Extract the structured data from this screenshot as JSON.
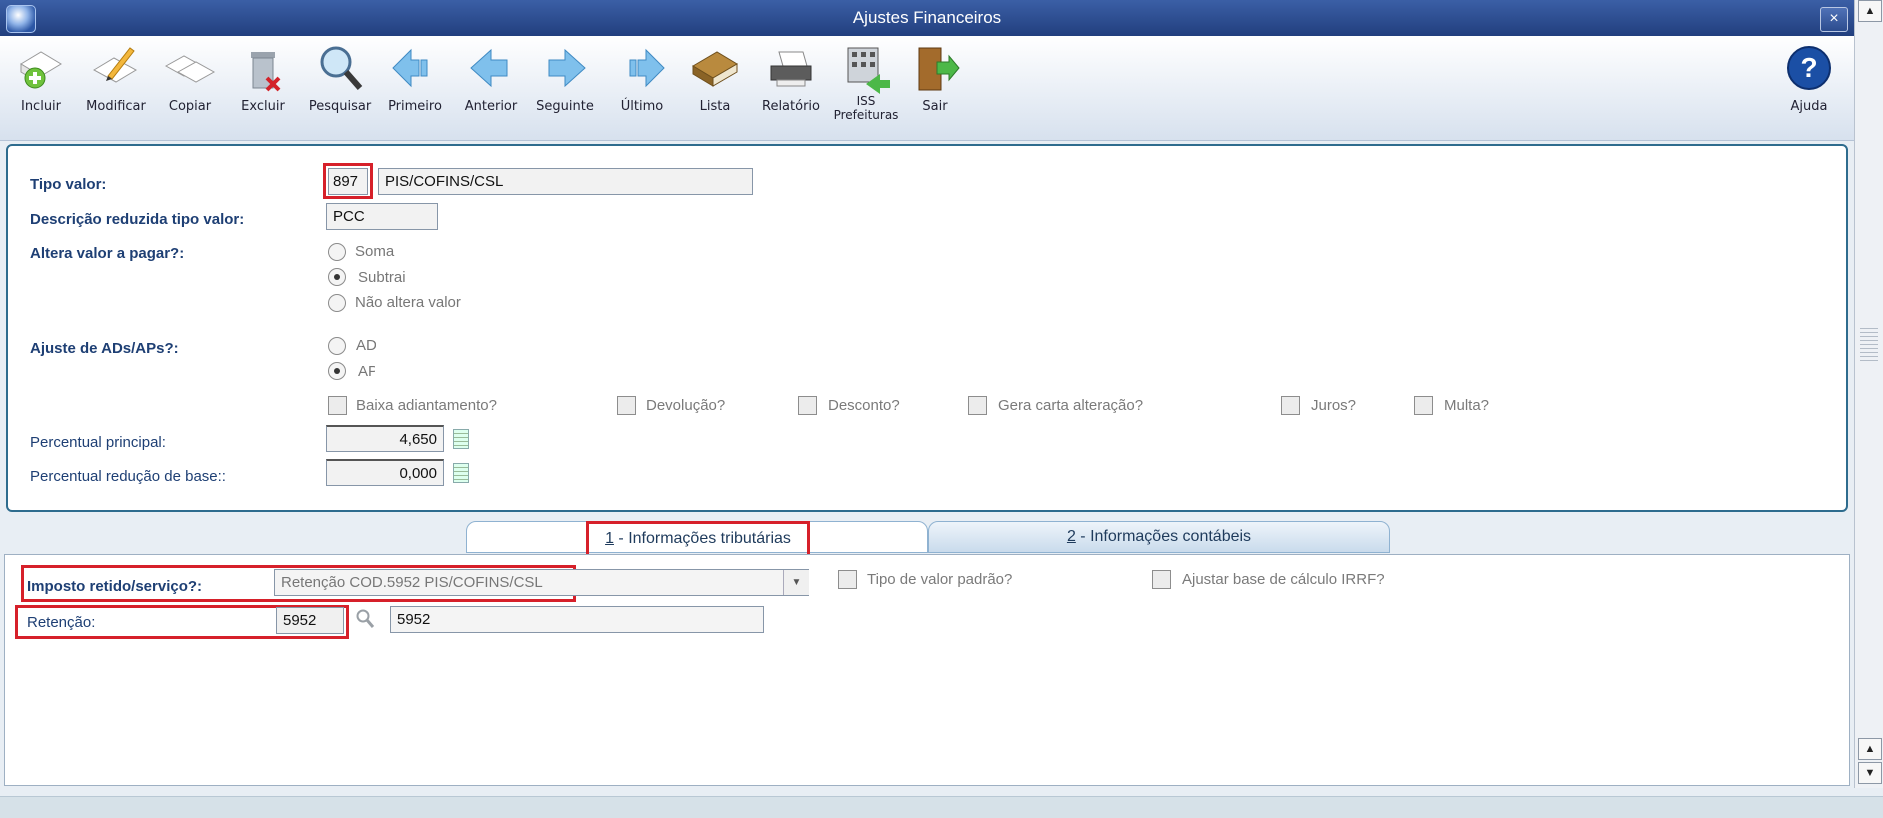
{
  "window": {
    "title": "Ajustes Financeiros",
    "close_label": "×"
  },
  "toolbar": {
    "items": [
      {
        "label": "Incluir",
        "icon": "add-document-icon"
      },
      {
        "label": "Modificar",
        "icon": "edit-document-icon"
      },
      {
        "label": "Copiar",
        "icon": "copy-documents-icon"
      },
      {
        "label": "Excluir",
        "icon": "trash-delete-icon"
      },
      {
        "label": "Pesquisar",
        "icon": "magnifier-icon"
      },
      {
        "label": "Primeiro",
        "icon": "first-arrow-icon"
      },
      {
        "label": "Anterior",
        "icon": "previous-arrow-icon"
      },
      {
        "label": "Seguinte",
        "icon": "next-arrow-icon"
      },
      {
        "label": "Último",
        "icon": "last-arrow-icon"
      },
      {
        "label": "Lista",
        "icon": "book-list-icon"
      },
      {
        "label": "Relatório",
        "icon": "printer-icon"
      },
      {
        "label": "ISS Prefeituras",
        "icon": "building-icon"
      },
      {
        "label": "Sair",
        "icon": "exit-door-icon"
      },
      {
        "label": "Ajuda",
        "icon": "help-question-icon"
      }
    ]
  },
  "form": {
    "tipo_valor": {
      "label": "Tipo valor:",
      "code": "897",
      "description": "PIS/COFINS/CSL"
    },
    "descricao_reduzida": {
      "label": "Descrição reduzida tipo valor:",
      "value": "PCC"
    },
    "altera_valor": {
      "label": "Altera valor a pagar?:",
      "options": [
        "Soma",
        "Subtrai",
        "Não altera valor"
      ],
      "selected": "Subtrai"
    },
    "ajuste_ads": {
      "label": "Ajuste de ADs/APs?:",
      "options": [
        "AD",
        "AP"
      ],
      "selected": "AP"
    },
    "checkboxes": [
      "Baixa adiantamento?",
      "Devolução?",
      "Desconto?",
      "Gera carta alteração?",
      "Juros?",
      "Multa?"
    ],
    "percentual_principal": {
      "label": "Percentual principal:",
      "value": "4,650"
    },
    "percentual_reducao": {
      "label": "Percentual redução de base::",
      "value": "0,000"
    }
  },
  "tabs": [
    {
      "key": "1",
      "label": " - Informações tributárias"
    },
    {
      "key": "2",
      "label": " - Informações contábeis"
    }
  ],
  "tributarias": {
    "imposto_retido": {
      "label": "Imposto retido/serviço?:",
      "value": "Retenção COD.5952 PIS/COFINS/CSL"
    },
    "tipo_valor_padrao": "Tipo de valor padrão?",
    "ajustar_base": "Ajustar base de cálculo IRRF?",
    "retencao": {
      "label": "Retenção:",
      "code": "5952",
      "description": "5952"
    }
  },
  "colors": {
    "title_bar": "#2b4b8f",
    "panel_border": "#2e6c8e",
    "highlight": "#d6202a",
    "label": "#1e3f74"
  }
}
